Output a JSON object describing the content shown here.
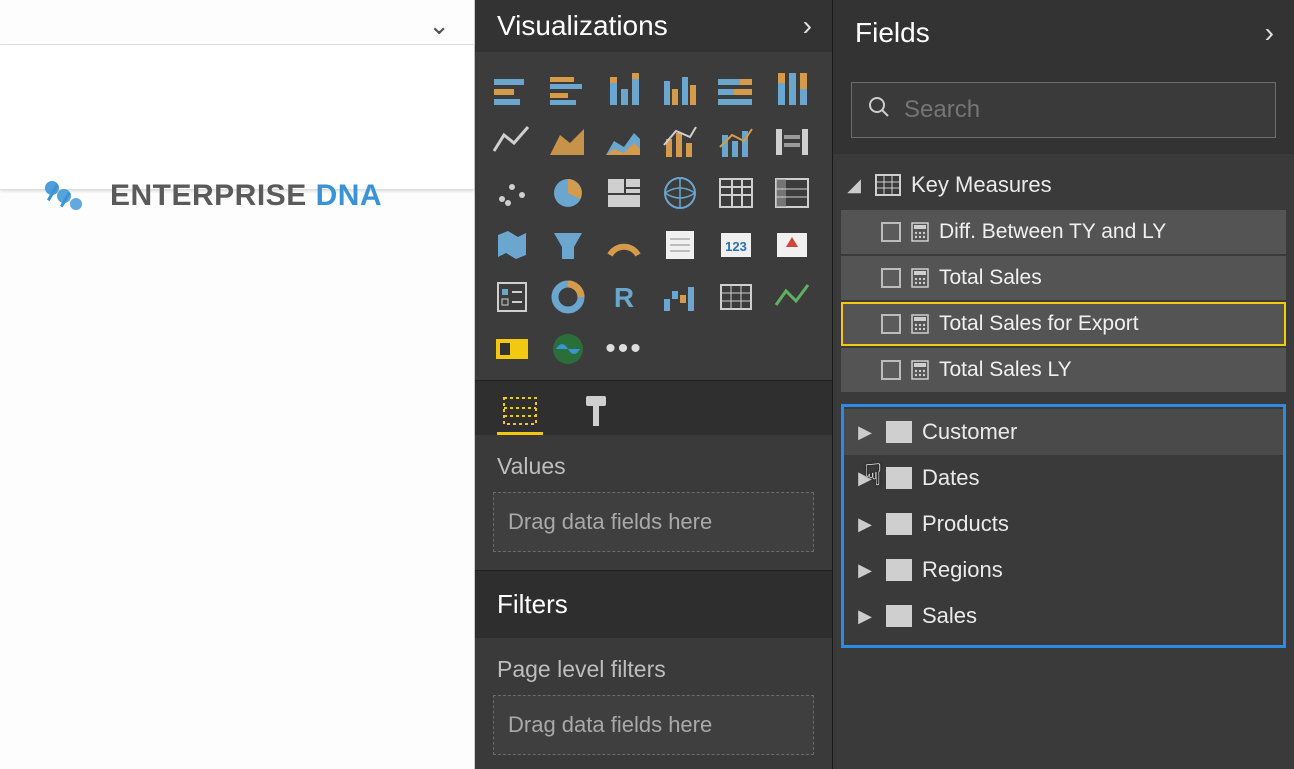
{
  "canvas": {
    "logo_primary": "ENTERPRISE",
    "logo_secondary": "DNA"
  },
  "visualizations": {
    "title": "Visualizations",
    "values_label": "Values",
    "values_placeholder": "Drag data fields here",
    "filters_title": "Filters",
    "page_filters_label": "Page level filters",
    "page_filters_placeholder": "Drag data fields here"
  },
  "fields": {
    "title": "Fields",
    "search_placeholder": "Search",
    "measures_table": "Key Measures",
    "measures": [
      "Diff. Between TY and LY",
      "Total Sales",
      "Total Sales for Export",
      "Total Sales LY"
    ],
    "selected_measure_index": 2,
    "tables": [
      "Customer",
      "Dates",
      "Products",
      "Regions",
      "Sales"
    ]
  }
}
